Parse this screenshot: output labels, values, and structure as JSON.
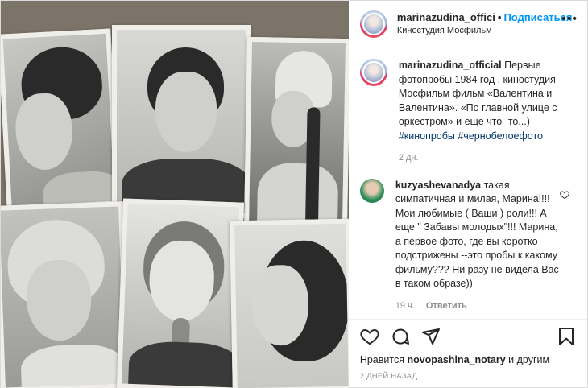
{
  "header": {
    "username": "marinazudina_offici",
    "separator": "•",
    "follow_label": "Подписаться",
    "location": "Киностудия Мосфильм",
    "more_label": "•••"
  },
  "caption": {
    "username": "marinazudina_official",
    "text": " Первые фотопробы 1984 год , киностудия Мосфильм фильм «Валентина и Валентина». «По главной улице с оркестром» и еще что- то...)",
    "hashtags": "#кинопробы #чернобелоефото",
    "time": "2 дн."
  },
  "comment": {
    "username": "kuzyashevanadya",
    "text": " такая симпатичная и милая, Марина!!!! Мои любимые ( Ваши ) роли!!! А еще \" Забавы молодых\"!!! Марина, а первое фото, где вы коротко подстрижены --это пробы к какому фильму??? Ни разу не видела Вас в таком образе))",
    "time": "19 ч.",
    "reply_label": "Ответить"
  },
  "likes": {
    "prefix": "Нравится ",
    "user": "novopashina_notary",
    "suffix": " и другим"
  },
  "post_date": "2 ДНЕЙ НАЗАД",
  "icons": {
    "like": "heart-icon",
    "comment": "comment-icon",
    "share": "share-icon",
    "save": "bookmark-icon"
  },
  "colors": {
    "follow": "#0095f6",
    "hashtag": "#00376b",
    "muted": "#8e8e8e"
  }
}
